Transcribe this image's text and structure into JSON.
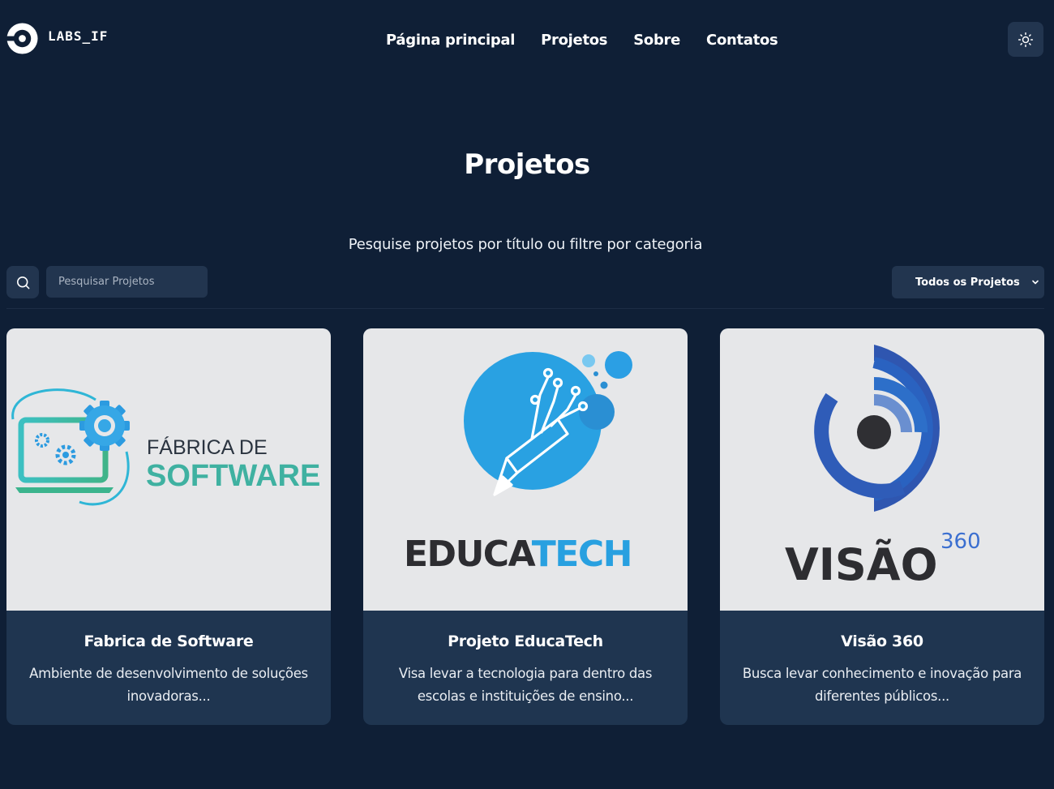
{
  "header": {
    "brand": "LABS_IF",
    "nav": [
      {
        "label": "Página principal"
      },
      {
        "label": "Projetos"
      },
      {
        "label": "Sobre"
      },
      {
        "label": "Contatos"
      }
    ],
    "theme_toggle_icon": "sun-icon"
  },
  "main": {
    "title": "Projetos",
    "subtitle": "Pesquise projetos por título ou filtre por categoria",
    "search": {
      "placeholder": "Pesquisar Projetos",
      "value": "",
      "icon": "search-icon"
    },
    "filter": {
      "selected": "Todos os Projetos",
      "icon": "chevron-down-icon"
    }
  },
  "projects": [
    {
      "title": "Fabrica de Software",
      "description": "Ambiente de desenvolvimento de soluções inovadoras...",
      "logo": {
        "line1": "FÁBRICA DE",
        "line2": "SOFTWARE"
      }
    },
    {
      "title": "Projeto EducaTech",
      "description": "Visa levar a tecnologia para dentro das escolas e instituições de ensino...",
      "logo": {
        "part1": "EDUCA",
        "part2": "TECH"
      }
    },
    {
      "title": "Visão 360",
      "description": "Busca levar conhecimento e inovação para diferentes públicos...",
      "logo": {
        "word": "VISÃO",
        "sup": "360"
      }
    }
  ],
  "colors": {
    "background": "#0f1f36",
    "surface": "#22354f",
    "card_body": "#1f3550",
    "card_image_bg": "#e6e7e9",
    "fabrica_teal": "#3fb1a1",
    "educatech_blue": "#28a0e0",
    "visao_blue": "#2f5cb8"
  }
}
